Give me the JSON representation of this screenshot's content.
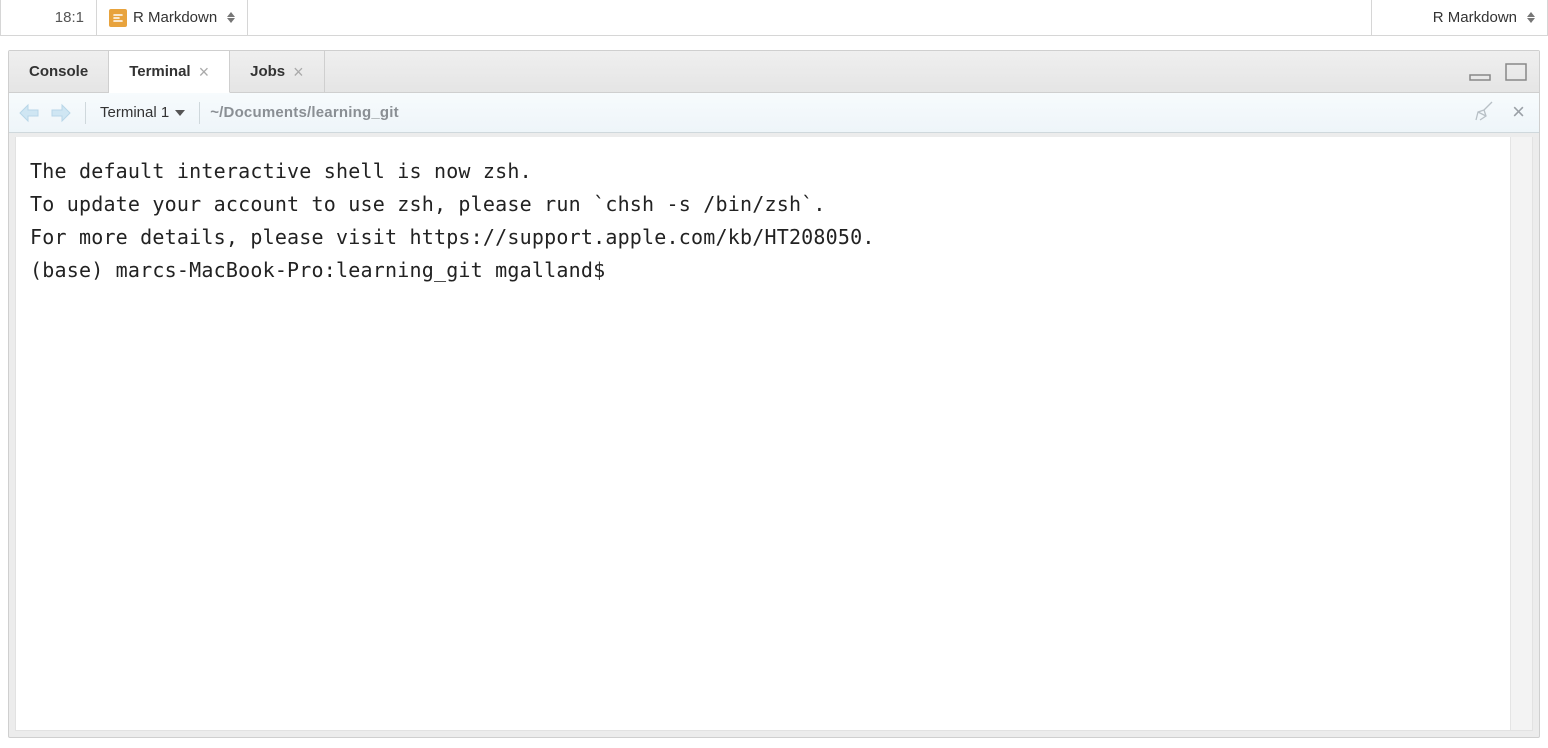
{
  "status_bar": {
    "cursor_position": "18:1",
    "mode_label": "R Markdown",
    "filetype_label": "R Markdown"
  },
  "tabs": {
    "console_label": "Console",
    "terminal_label": "Terminal",
    "jobs_label": "Jobs",
    "active": "Terminal"
  },
  "terminal_toolbar": {
    "picker_label": "Terminal 1",
    "cwd": "~/Documents/learning_git"
  },
  "terminal_output": {
    "line1": "The default interactive shell is now zsh.",
    "line2": "To update your account to use zsh, please run `chsh -s /bin/zsh`.",
    "line3": "For more details, please visit https://support.apple.com/kb/HT208050.",
    "prompt": "(base) marcs-MacBook-Pro:learning_git mgalland$"
  }
}
